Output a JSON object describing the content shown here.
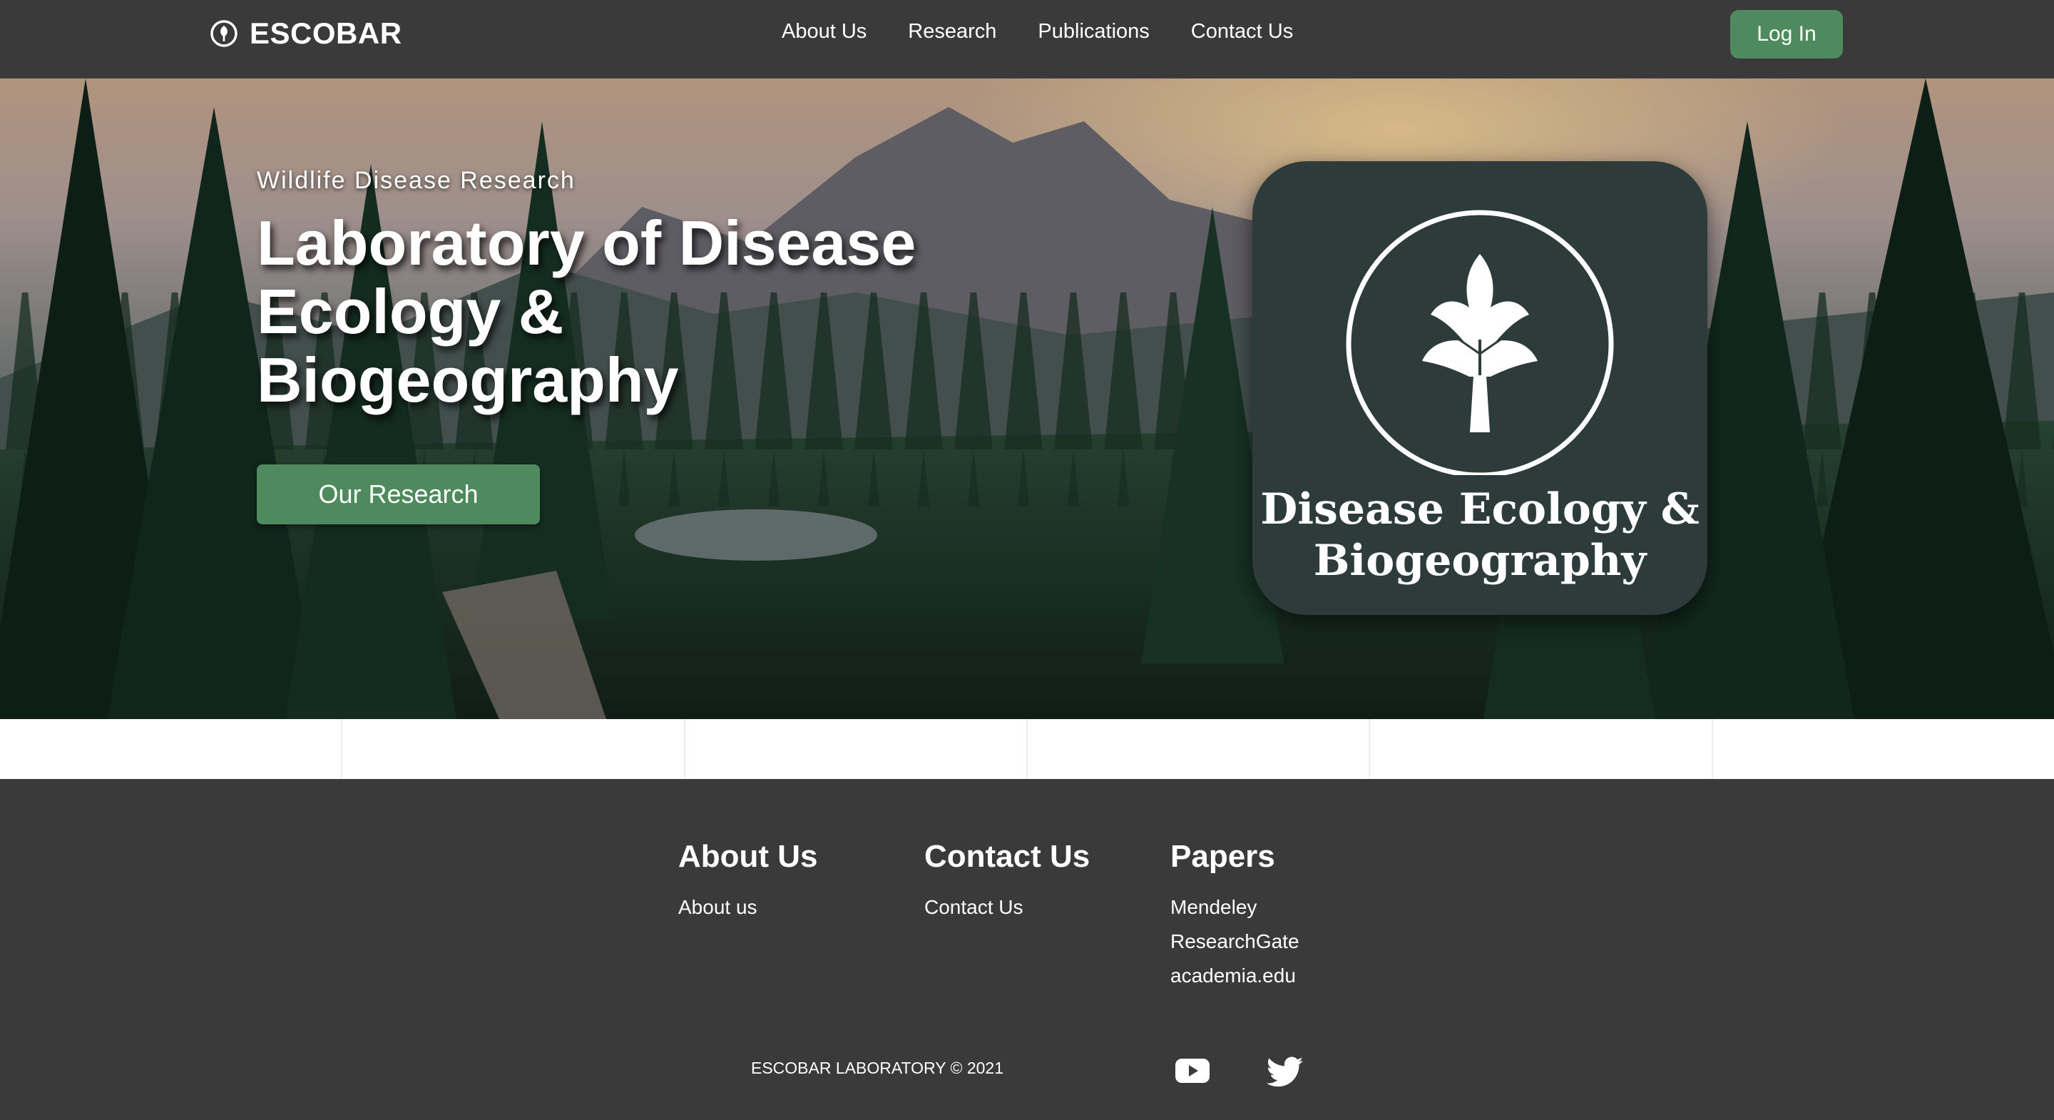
{
  "nav": {
    "brand": "ESCOBAR",
    "brand_icon": "leaf-circle-icon",
    "links": [
      "About Us",
      "Research",
      "Publications",
      "Contact Us"
    ],
    "login_label": "Log In"
  },
  "hero": {
    "kicker": "Wildlife Disease Research",
    "title_lines": [
      "Laboratory of Disease",
      "Ecology &",
      "Biogeography"
    ],
    "cta_label": "Our Research",
    "logo_caption_lines": [
      "Disease Ecology &",
      "Biogeography"
    ],
    "logo_icon": "tree-circle-icon"
  },
  "footer": {
    "columns": [
      {
        "heading": "About Us",
        "links": [
          "About us"
        ]
      },
      {
        "heading": "Contact Us",
        "links": [
          "Contact Us"
        ]
      },
      {
        "heading": "Papers",
        "links": [
          "Mendeley",
          "ResearchGate",
          "academia.edu"
        ]
      }
    ],
    "copyright": "ESCOBAR LABORATORY © 2021",
    "social": [
      "youtube-icon",
      "twitter-icon"
    ]
  },
  "colors": {
    "nav_bg": "#3a3a3a",
    "accent_green": "#4e8a5d",
    "logo_card": "#2d3c3b",
    "footer_bg": "#3a3a3a"
  }
}
